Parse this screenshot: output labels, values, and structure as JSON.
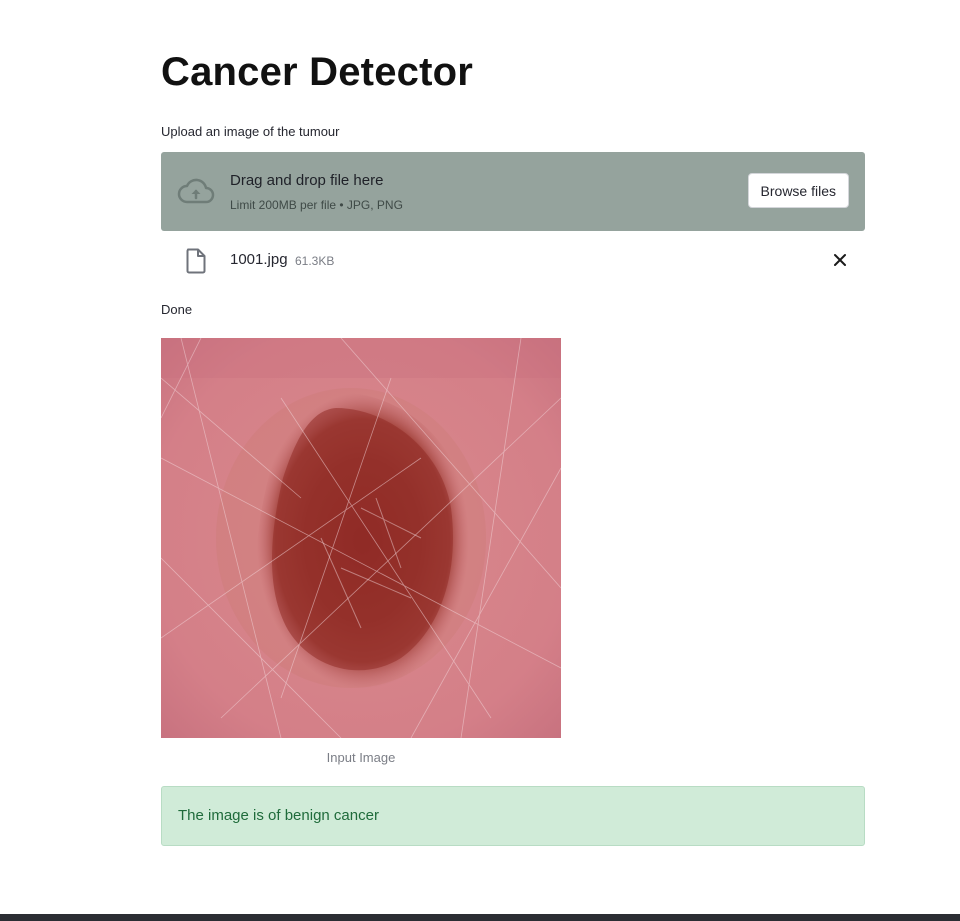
{
  "app": {
    "title": "Cancer Detector"
  },
  "uploader": {
    "label": "Upload an image of the tumour",
    "drop_title": "Drag and drop file here",
    "drop_limit": "Limit 200MB per file • JPG, PNG",
    "browse_label": "Browse files",
    "icon": "cloud-upload-icon"
  },
  "file": {
    "name": "1001.jpg",
    "size": "61.3KB",
    "icon": "file-icon",
    "remove_icon": "close-icon"
  },
  "status": {
    "text": "Done"
  },
  "image": {
    "caption": "Input Image"
  },
  "result": {
    "text": "The image is of benign cancer"
  },
  "colors": {
    "dropzone_bg": "#95a39d",
    "success_bg": "#d0ebd8",
    "success_text": "#1f6b3b"
  }
}
